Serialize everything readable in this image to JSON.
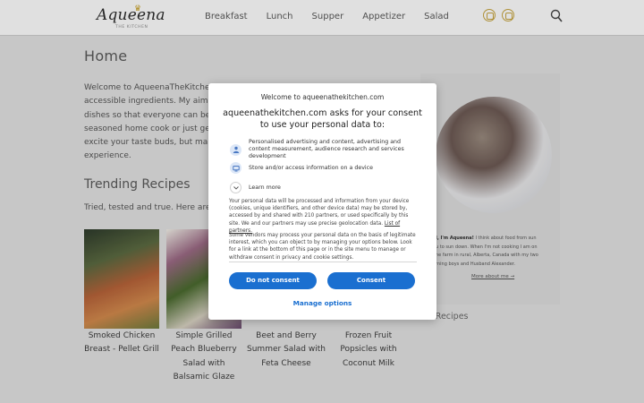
{
  "header": {
    "logo": {
      "script": "Aqueena",
      "sub": "THE KITCHEN"
    },
    "nav": [
      "Breakfast",
      "Lunch",
      "Supper",
      "Appetizer",
      "Salad"
    ],
    "icons": [
      "instagram-icon",
      "pinterest-icon",
      "search-icon"
    ],
    "accent_color": "#c8a640"
  },
  "main": {
    "title": "Home",
    "intro_lines": [
      "Welcome to AqueenaTheKitchen!",
      "accessible ingredients. My aim is",
      "dishes so that everyone can be th",
      "seasoned home cook or just gett",
      "excite your taste buds, but make",
      "experience."
    ],
    "trending_title": "Trending Recipes",
    "tried_text": "Tried, tested and true. Here are th",
    "recipes": [
      {
        "title": "Smoked Chicken Breast - Pellet Grill"
      },
      {
        "title": "Simple Grilled Peach Blueberry Salad with Balsamic Glaze"
      },
      {
        "title": "Beet and Berry Summer Salad with Feta Cheese"
      },
      {
        "title": "Frozen Fruit Popsicles with Coconut Milk"
      }
    ]
  },
  "sidebar": {
    "greeting": "I, I'm Aqueena!",
    "about_lines": [
      "I think about food from sun",
      "u to sun down. When I'm not cooking I am on",
      "he farm in rural, Alberta, Canada with my two",
      "rning boys and Husband Alexander."
    ],
    "more_about": "More about me →",
    "new_recipes": "w Recipes"
  },
  "consent": {
    "site_top": "Welcome to aqueenathekitchen.com",
    "heading": "aqueenathekitchen.com asks for your consent to use your personal data to:",
    "purposes": [
      {
        "icon": "person-icon",
        "text": "Personalised advertising and content, advertising and content measurement, audience research and services development"
      },
      {
        "icon": "device-icon",
        "text": "Store and/or access information on a device"
      }
    ],
    "learn_more": "Learn more",
    "body1": "Your personal data will be processed and information from your device (cookies, unique identifiers, and other device data) may be stored by, accessed by and shared with 210 partners, or used specifically by this site. We and our partners may use precise geolocation data.",
    "list_link": "List of partners.",
    "body2": "Some vendors may process your personal data on the basis of legitimate interest, which you can object to by managing your options below. Look for a link at the bottom of this page or in the site menu to manage or withdraw consent in privacy and cookie settings.",
    "do_not_consent": "Do not consent",
    "consent": "Consent",
    "manage": "Manage options",
    "button_color": "#1a6fd0"
  }
}
